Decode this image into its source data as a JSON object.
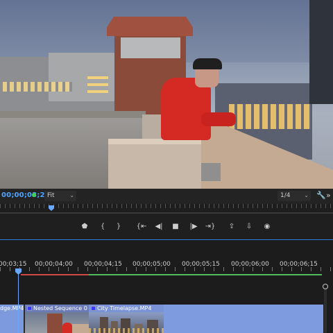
{
  "monitor": {
    "timecode": "00;00;03;20",
    "zoom": {
      "selected": "Fit"
    },
    "resolution": {
      "selected": "1/4"
    },
    "icons": [
      "wrench-icon",
      "more-icon"
    ]
  },
  "transport": {
    "buttons": [
      {
        "name": "add-marker-button",
        "glyph": "⬟"
      },
      {
        "name": "mark-in-button",
        "glyph": "{"
      },
      {
        "name": "mark-out-button",
        "glyph": "}"
      },
      {
        "name": "go-to-in-button",
        "glyph": "{⇤"
      },
      {
        "name": "step-back-button",
        "glyph": "◀|"
      },
      {
        "name": "stop-button",
        "glyph": "■"
      },
      {
        "name": "step-forward-button",
        "glyph": "|▶"
      },
      {
        "name": "go-to-out-button",
        "glyph": "⇥}"
      },
      {
        "name": "lift-button",
        "glyph": "⇪"
      },
      {
        "name": "extract-button",
        "glyph": "⇩"
      },
      {
        "name": "export-frame-button",
        "glyph": "📷"
      }
    ]
  },
  "timeline": {
    "timecodes": [
      "00;03;15",
      "00;00;04;00",
      "00;00;04;15",
      "00;00;05;00",
      "00;00;05;15",
      "00;00;06;00",
      "00;00;06;15"
    ],
    "clips": [
      {
        "label": "dge.MP4"
      },
      {
        "label": "Nested Sequence 0"
      },
      {
        "label": "City Timelapse.MP4"
      }
    ]
  },
  "colors": {
    "accent": "#4ea4ff",
    "playhead": "#6aa8ff",
    "work_area_red": "#d24646",
    "work_area_green": "#4ec15c",
    "clip_blue": "#7f9be0"
  }
}
